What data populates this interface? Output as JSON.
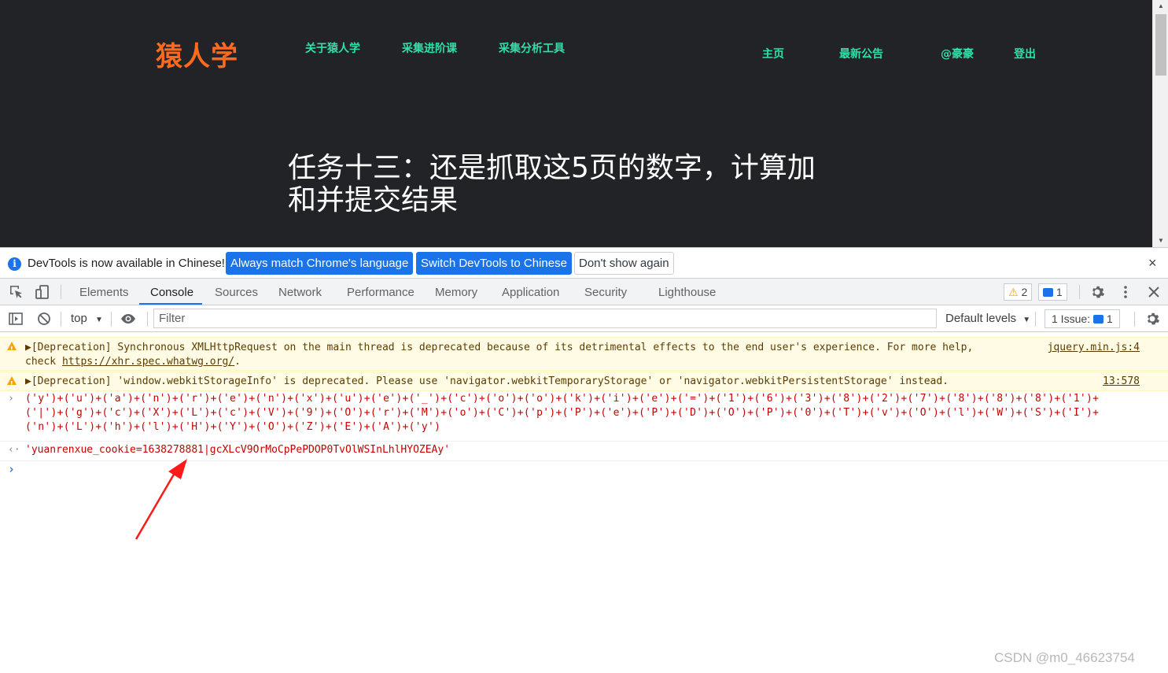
{
  "site": {
    "logo": "猿人学",
    "nav_left": [
      "关于猿人学",
      "采集进阶课",
      "采集分析工具"
    ],
    "nav_right": [
      "主页",
      "最新公告",
      "@豪豪",
      "登出"
    ],
    "hero_line1": "任务十三：还是抓取这5页的数字，计算加",
    "hero_line2": "和并提交结果"
  },
  "infobar": {
    "text": "DevTools is now available in Chinese!",
    "btn_match": "Always match Chrome's language",
    "btn_switch": "Switch DevTools to Chinese",
    "btn_dismiss": "Don't show again",
    "close": "×"
  },
  "tabs": [
    "Elements",
    "Console",
    "Sources",
    "Network",
    "Performance",
    "Memory",
    "Application",
    "Security",
    "Lighthouse"
  ],
  "active_tab": "Console",
  "counters": {
    "warnings": "2",
    "messages": "1"
  },
  "console_toolbar": {
    "context": "top",
    "filter_placeholder": "Filter",
    "levels": "Default levels",
    "issues": "1 Issue:",
    "issues_count": "1"
  },
  "log": {
    "warn1_line1": "▶[Deprecation] Synchronous XMLHttpRequest on the main thread is deprecated because of its detrimental effects to the end user's experience. For more help,",
    "warn1_line2_prefix": "check ",
    "warn1_link": "https://xhr.spec.whatwg.org/",
    "warn1_line2_suffix": ".",
    "warn1_src": "jquery.min.js:4",
    "warn2": "▶[Deprecation] 'window.webkitStorageInfo' is deprecated. Please use 'navigator.webkitTemporaryStorage' or 'navigator.webkitPersistentStorage' instead.",
    "warn2_src": "13:578",
    "expr_line1": "('y')+('u')+('a')+('n')+('r')+('e')+('n')+('x')+('u')+('e')+('_')+('c')+('o')+('o')+('k')+('i')+('e')+('=')+('1')+('6')+('3')+('8')+('2')+('7')+('8')+('8')+('8')+('1')+",
    "expr_line2": "('|')+('g')+('c')+('X')+('L')+('c')+('V')+('9')+('O')+('r')+('M')+('o')+('C')+('p')+('P')+('e')+('P')+('D')+('O')+('P')+('0')+('T')+('v')+('O')+('l')+('W')+('S')+('I')+",
    "expr_line3": "('n')+('L')+('h')+('l')+('H')+('Y')+('O')+('Z')+('E')+('A')+('y')",
    "result": "'yuanrenxue_cookie=1638278881|gcXLcV9OrMoCpPePDOP0TvOlWSInLhlHYOZEAy'"
  },
  "watermark": "CSDN @m0_46623754",
  "colors": {
    "accent": "#1a73e8",
    "logo": "#ff6a1c",
    "nav": "#2ee0a8",
    "string": "#c80000",
    "annotation_arrow": "#ff1a1a"
  }
}
